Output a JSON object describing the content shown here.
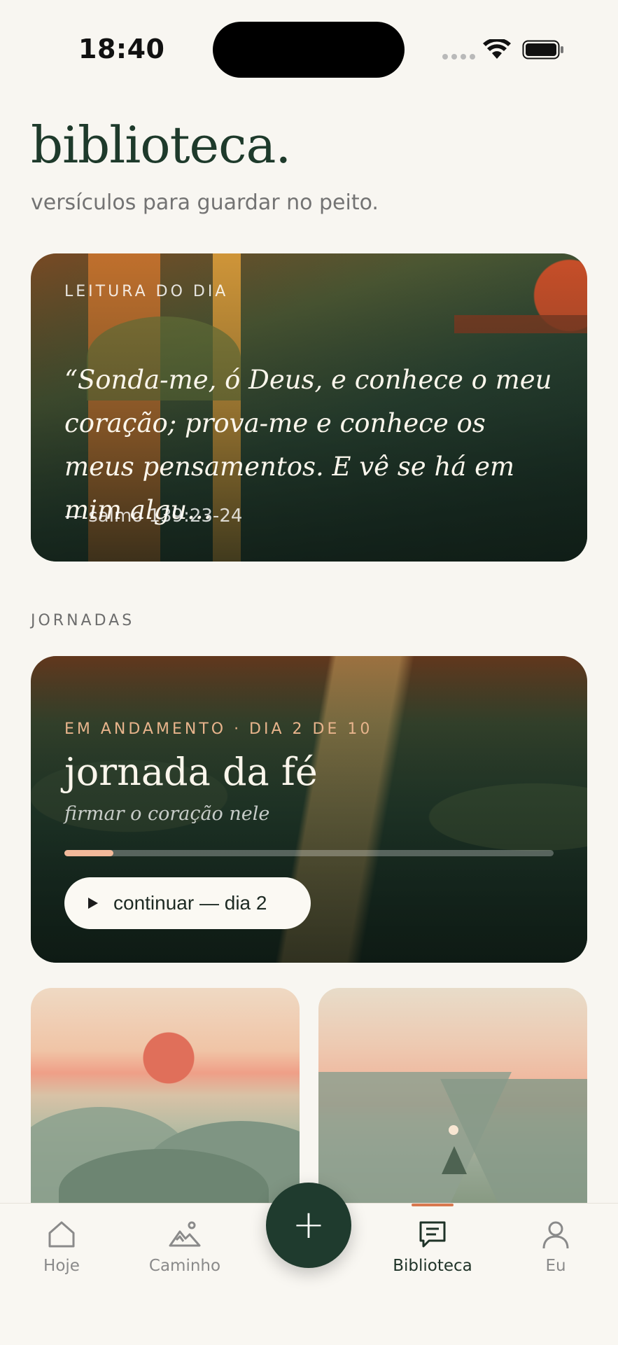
{
  "status_bar": {
    "time": "18:40"
  },
  "header": {
    "title": "biblioteca.",
    "subtitle": "versículos para guardar no peito."
  },
  "daily_card": {
    "eyebrow": "LEITURA DO DIA",
    "quote": "“Sonda-me, ó Deus, e conhece o meu coração; prova-me e conhece os meus pensamentos. E vê se há em mim algu...",
    "reference": "— salmo 139:23-24"
  },
  "journeys": {
    "section_label": "JORNADAS",
    "current": {
      "eyebrow": "EM ANDAMENTO · DIA 2 DE 10",
      "title": "jornada da fé",
      "subtitle": "firmar o coração nele",
      "progress": 0.1,
      "button_label": "continuar — dia 2"
    }
  },
  "nav": {
    "items": [
      {
        "label": "Hoje",
        "icon": "home-icon"
      },
      {
        "label": "Caminho",
        "icon": "mountain-icon"
      },
      {
        "label": "Biblioteca",
        "icon": "message-square-icon",
        "active": true
      },
      {
        "label": "Eu",
        "icon": "user-icon"
      }
    ],
    "fab_symbol": "+"
  },
  "colors": {
    "background": "#f8f6f1",
    "primary": "#1f3b2e",
    "accent": "#d9784f",
    "progress": "#f2b99a"
  }
}
